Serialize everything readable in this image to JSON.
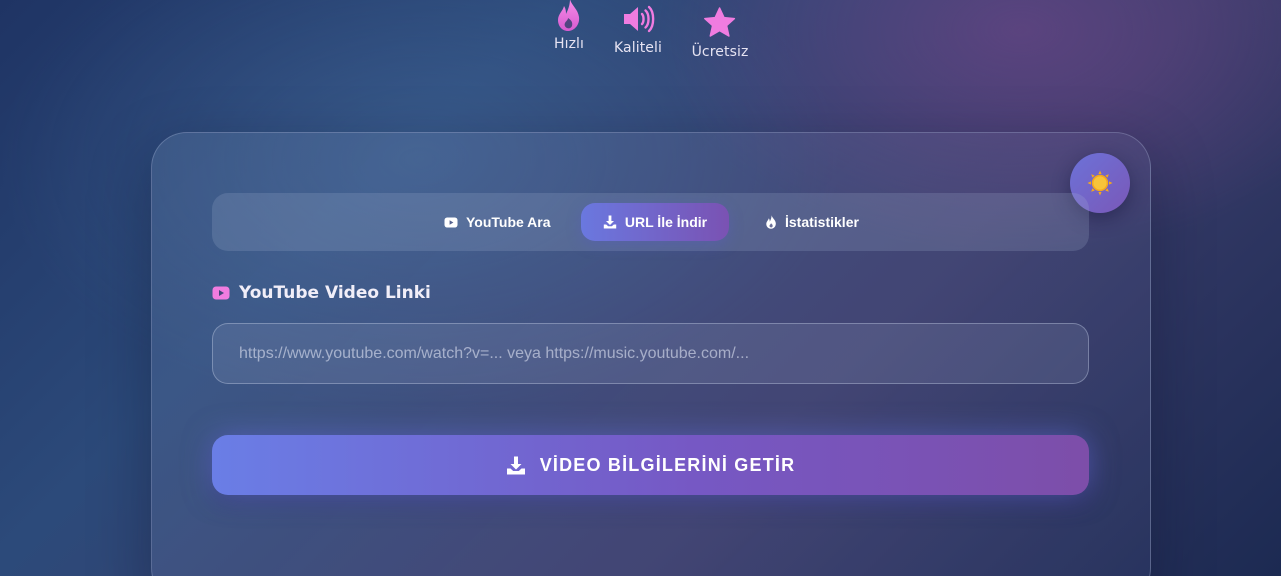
{
  "features": [
    {
      "icon": "flame-icon",
      "label": "Hızlı"
    },
    {
      "icon": "speaker-icon",
      "label": "Kaliteli"
    },
    {
      "icon": "star-icon",
      "label": "Ücretsiz"
    }
  ],
  "theme_toggle": {
    "icon": "sun-icon"
  },
  "tabs": [
    {
      "icon": "youtube-icon",
      "label": "YouTube Ara",
      "active": false
    },
    {
      "icon": "download-icon",
      "label": "URL İle İndir",
      "active": true
    },
    {
      "icon": "flame-icon",
      "label": "İstatistikler",
      "active": false
    }
  ],
  "url_field": {
    "label": "YouTube Video Linki",
    "icon": "youtube-icon",
    "value": "",
    "placeholder": "https://www.youtube.com/watch?v=... veya https://music.youtube.com/..."
  },
  "submit": {
    "icon": "download-icon",
    "label": "VİDEO BİLGİLERİNİ GETİR"
  },
  "colors": {
    "accent_start": "#6a7ee6",
    "accent_end": "#7d4ea9",
    "feature_icon": "#f07ce0",
    "sun": "#f5b521"
  }
}
